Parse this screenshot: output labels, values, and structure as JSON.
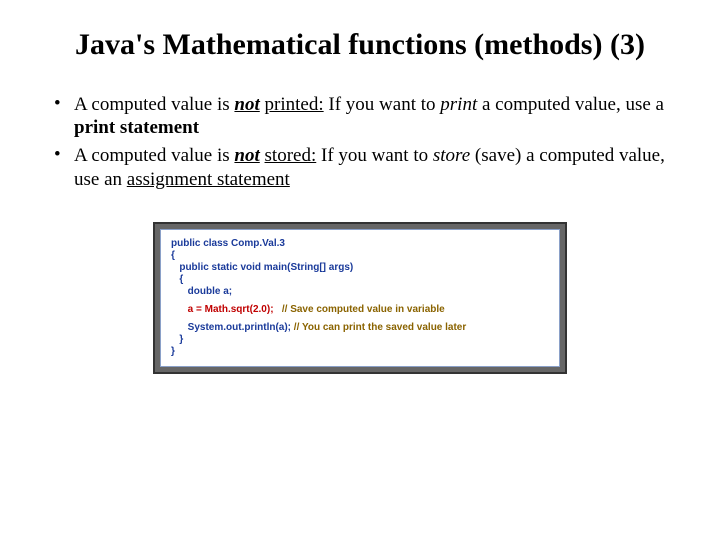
{
  "title": "Java's Mathematical functions (methods) (3)",
  "bullets": {
    "b1": {
      "pre": "A computed value is ",
      "not": "not",
      "sp1": " ",
      "printed": "printed:",
      "mid": " If you want to ",
      "print": "print",
      "mid2": " a computed value, use a ",
      "pstmt": "print statement"
    },
    "b2": {
      "pre": "A computed value is ",
      "not": "not",
      "sp1": " ",
      "stored": "stored:",
      "mid": " If you want to ",
      "store": "store",
      "mid2": " (save) a computed value, use an ",
      "assign": "assignment statement"
    }
  },
  "code": {
    "l1": "public class Comp.Val.3",
    "l2": "{",
    "l3": "   public static void main(String[] args)",
    "l4": "   {",
    "l5": "      double a;",
    "l6a": "      a = Math.sqrt(2.0);   ",
    "l6b": "// Save computed value in variable",
    "l7a": "      System.out.println(a); ",
    "l7b": "// You can print the saved value later",
    "l8": "   }",
    "l9": "}"
  }
}
